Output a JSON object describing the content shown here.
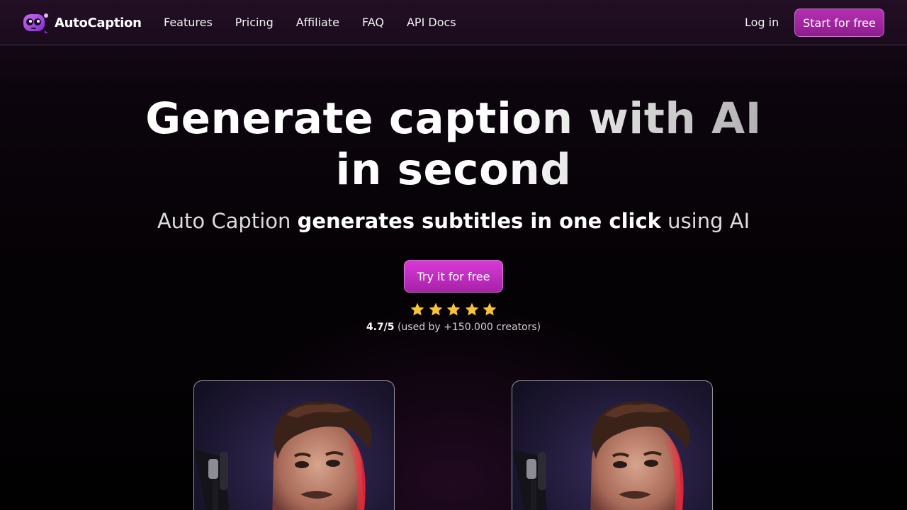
{
  "brand": {
    "name": "AutoCaption",
    "accent_color": "#b62fb4",
    "logo_icon": "robot-face-logo"
  },
  "nav": {
    "links": [
      "Features",
      "Pricing",
      "Affiliate",
      "FAQ",
      "API Docs"
    ],
    "login_label": "Log in",
    "start_label": "Start for free"
  },
  "hero": {
    "title_line1": "Generate caption with AI",
    "title_line2": "in second",
    "subtitle_part1": "Auto Caption ",
    "subtitle_part2": "generates subtitles in one click",
    "subtitle_part3": " using AI",
    "cta_label": "Try it for free",
    "rating_stars": 5,
    "rating_score": "4.7/5",
    "rating_text": " (used by +150.000 creators)"
  },
  "videos": {
    "items": [
      {
        "name": "video-preview-left"
      },
      {
        "name": "video-preview-right"
      }
    ]
  }
}
